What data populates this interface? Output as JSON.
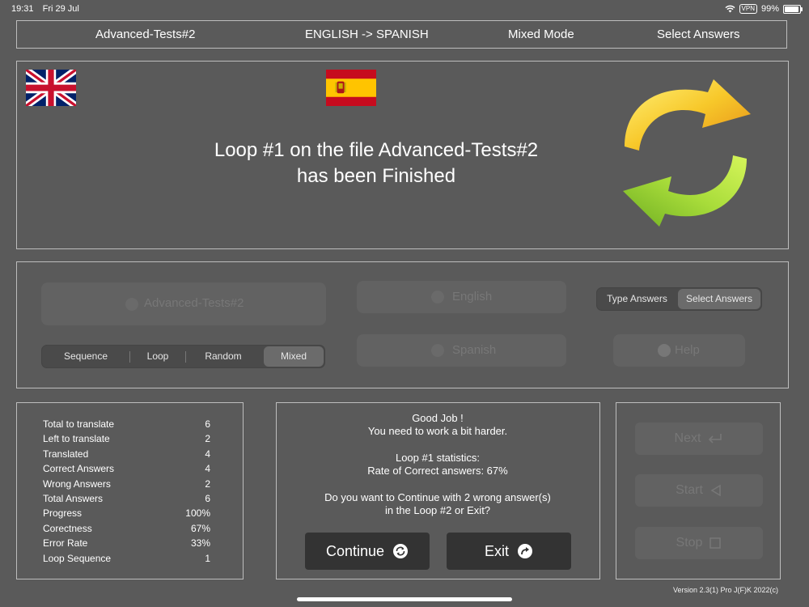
{
  "status": {
    "time": "19:31",
    "date": "Fri 29 Jul",
    "vpn": "VPN",
    "battery": "99%",
    "battery_level": 0.99
  },
  "header": {
    "file": "Advanced-Tests#2",
    "direction": "ENGLISH -> SPANISH",
    "mode": "Mixed Mode",
    "answers": "Select Answers"
  },
  "result": {
    "line1": "Loop #1 on the file Advanced-Tests#2",
    "line2": "has been Finished"
  },
  "settings": {
    "file_button": "Advanced-Tests#2",
    "source_language": "English",
    "target_language": "Spanish",
    "help": "Help",
    "order_options": [
      "Sequence",
      "Loop",
      "Random",
      "Mixed"
    ],
    "order_selected": "Mixed",
    "answer_options": [
      "Type Answers",
      "Select Answers"
    ],
    "answer_selected": "Select Answers"
  },
  "stats": [
    {
      "label": "Total to translate",
      "value": "6"
    },
    {
      "label": "Left to translate",
      "value": "2"
    },
    {
      "label": "Translated",
      "value": "4"
    },
    {
      "label": "Correct Answers",
      "value": "4"
    },
    {
      "label": "Wrong Answers",
      "value": "2"
    },
    {
      "label": "Total Answers",
      "value": "6"
    },
    {
      "label": "Progress",
      "value": "100%"
    },
    {
      "label": "Corectness",
      "value": "67%"
    },
    {
      "label": "Error Rate",
      "value": "33%"
    },
    {
      "label": "Loop Sequence",
      "value": "1"
    }
  ],
  "message": {
    "line1": "Good Job !",
    "line2": "You need to work a bit harder.",
    "line3": "Loop #1 statistics:",
    "line4": "Rate of Correct answers: 67%",
    "line5": "Do you want to Continue with 2 wrong answer(s)",
    "line6": "in the Loop #2 or Exit?"
  },
  "actions": {
    "continue": "Continue",
    "exit": "Exit"
  },
  "controls": {
    "next": "Next",
    "start": "Start",
    "stop": "Stop"
  },
  "version": "Version 2.3(1) Pro J(F)K 2022(c)"
}
